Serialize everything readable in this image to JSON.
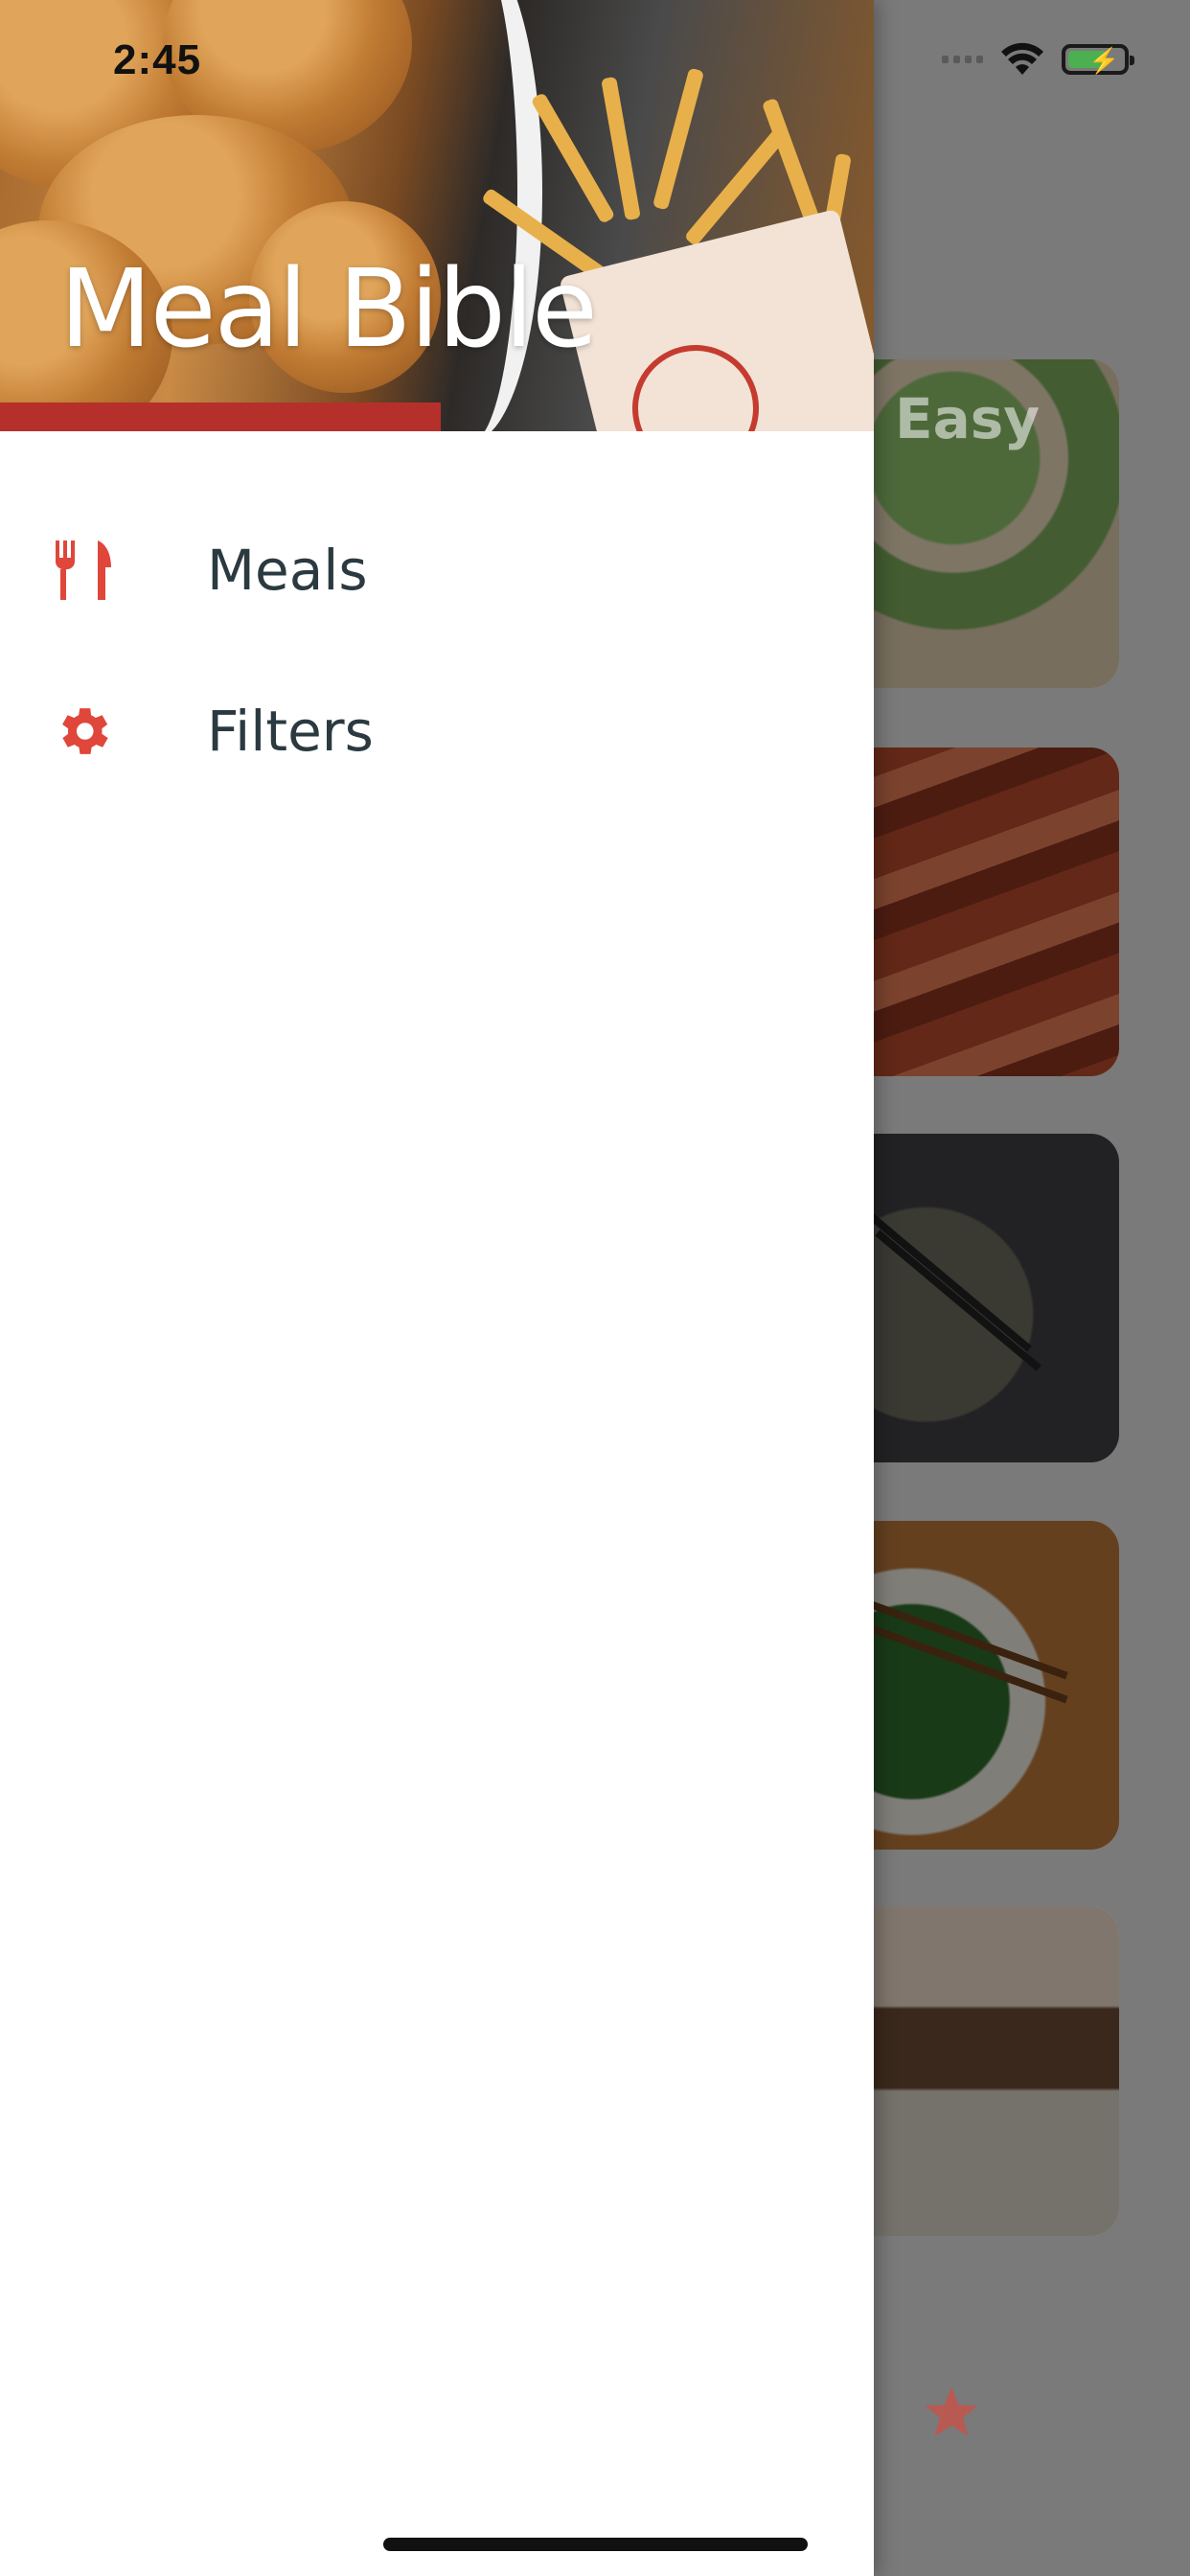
{
  "status_bar": {
    "time": "2:45",
    "icons": [
      "cellular-signal-icon",
      "wifi-icon",
      "battery-charging-icon"
    ]
  },
  "drawer": {
    "title": "Meal Bible",
    "items": [
      {
        "label": "Meals",
        "icon": "utensils-icon"
      },
      {
        "label": "Filters",
        "icon": "gear-icon"
      }
    ]
  },
  "background": {
    "categories": [
      {
        "label": "Easy"
      },
      {
        "label": ""
      },
      {
        "label": ""
      },
      {
        "label": ""
      },
      {
        "label": ""
      }
    ],
    "tab_icon": "star-icon"
  },
  "colors": {
    "accent": "#e0463a",
    "menu_text": "#2b3a40",
    "drawer_bg": "#ffffff"
  }
}
